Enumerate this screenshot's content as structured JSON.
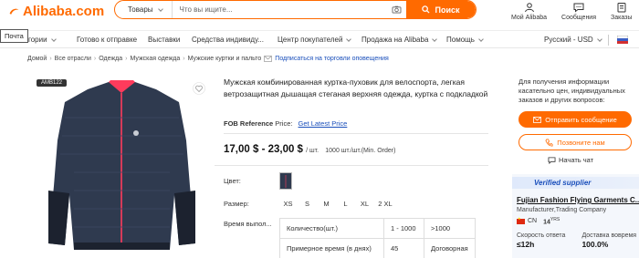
{
  "header": {
    "logo_text": "Alibaba.com",
    "search_category": "Товары",
    "search_placeholder": "Что вы ищите...",
    "search_button": "Поиск",
    "icons": [
      {
        "name": "user-icon",
        "label": "Мой Alibaba"
      },
      {
        "name": "message-icon",
        "label": "Сообщения"
      },
      {
        "name": "orders-icon",
        "label": "Заказы"
      }
    ]
  },
  "tooltip": "Почта",
  "nav": {
    "categories": "Категории",
    "ready": "Готово к отправке",
    "exhibitions": "Выставки",
    "personal": "Средства индивиду...",
    "buyer_center": "Центр покупателей",
    "sell": "Продажа на Alibaba",
    "help": "Помощь",
    "lang_currency": "Русский - USD"
  },
  "breadcrumb": {
    "items": [
      "Домой",
      "Все отрасли",
      "Одежда",
      "Мужская одежда",
      "Мужские куртки и пальто"
    ],
    "subscribe": "Подписаться на торговли оповещения"
  },
  "product": {
    "tag": "AMB122",
    "title": "Мужская комбинированная куртка-пуховик для велоспорта, легкая ветрозащитная дышащая стеганая верхняя одежда, куртка с подкладкой",
    "fob_label": "FOB Reference",
    "fob_label2": "Price:",
    "fob_link": "Get Latest Price",
    "price": "17,00 $ - 23,00 $",
    "price_unit": "/ шт.",
    "moq": "1000 шт./шт.(Min. Order)",
    "color_label": "Цвет:",
    "size_label": "Размер:",
    "sizes": [
      "XS",
      "S",
      "M",
      "L",
      "XL",
      "2 XL"
    ],
    "lead_label": "Время выпол...",
    "qty_table": {
      "row1": [
        "Количество(шт.)",
        "1 - 1000",
        ">1000"
      ],
      "row2": [
        "Примерное время (в днях)",
        "45",
        "Договорная"
      ]
    },
    "colors": {
      "jacket": "#2f3a4f",
      "accent": "#ff3b5c"
    }
  },
  "contact": {
    "info_text": "Для получения информации касательно цен, индивидуальных заказов и других вопросов:",
    "send_message": "Отправить сообщение",
    "call_us": "Позвоните нам",
    "start_chat": "Начать чат"
  },
  "supplier": {
    "badge": "Verified supplier",
    "name": "Fujian Fashion Flying Garments C...",
    "type": "Manufacturer,Trading Company",
    "country": "CN",
    "years": "14",
    "years_unit": "YRS",
    "response_time_label": "Скорость ответа",
    "response_time": "≤12h",
    "delivery_label": "Доставка вовремя",
    "delivery": "100.0%"
  },
  "accent": "#ff6a00"
}
